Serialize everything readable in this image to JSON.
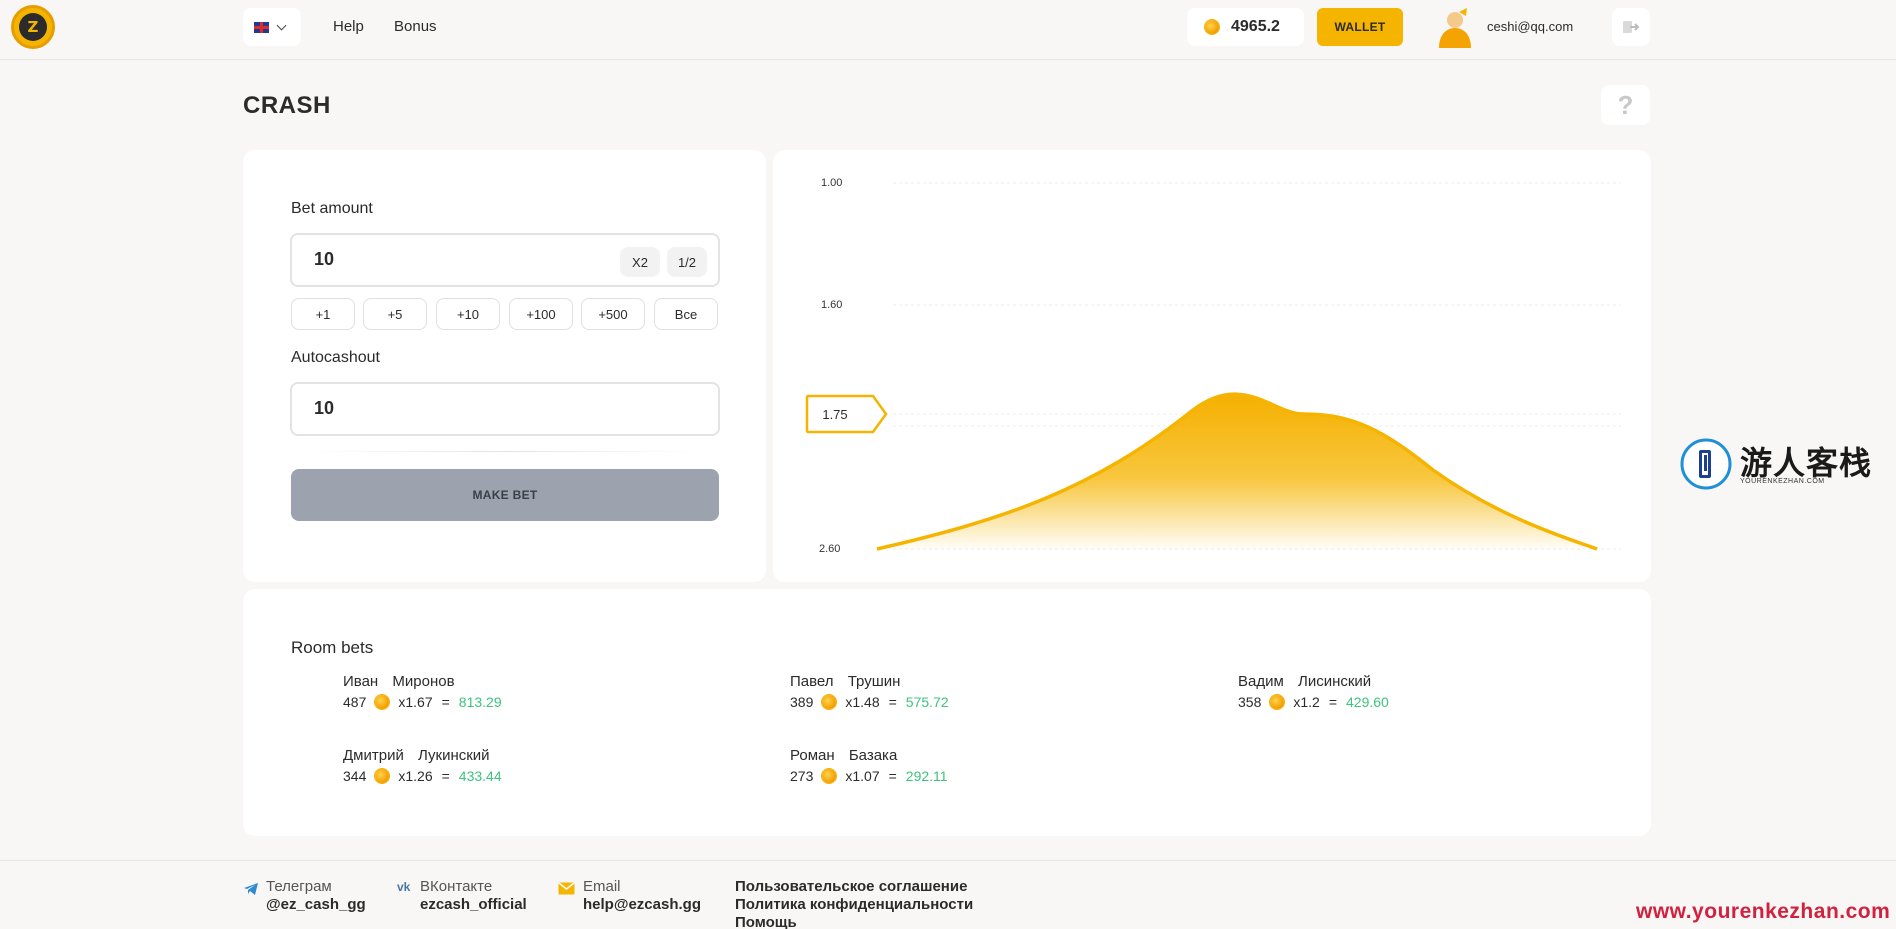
{
  "header": {
    "nav": [
      "Help",
      "Bonus"
    ],
    "balance": "4965.2",
    "wallet_label": "WALLET",
    "user_email": "ceshi@qq.com"
  },
  "page": {
    "title": "CRASH",
    "help_glyph": "?"
  },
  "bet": {
    "amount_label": "Bet amount",
    "amount_value": "10",
    "double_label": "X2",
    "half_label": "1/2",
    "quick_adds": [
      "+1",
      "+5",
      "+10",
      "+100",
      "+500",
      "Все"
    ],
    "autocashout_label": "Autocashout",
    "autocashout_value": "10",
    "make_bet_label": "MAKE BET"
  },
  "chart_data": {
    "type": "area",
    "y_ticks": [
      "1.00",
      "1.60",
      "2.60"
    ],
    "current_marker": "1.75",
    "color": "#f5b400",
    "shape": "bell curve peaking near the 1.75 marker"
  },
  "room_bets": {
    "title": "Room bets",
    "entries": [
      {
        "first": "Иван",
        "last": "Миронов",
        "amount": "487",
        "mult": "x1.67",
        "eq": "=",
        "win": "813.29"
      },
      {
        "first": "Павел",
        "last": "Трушин",
        "amount": "389",
        "mult": "x1.48",
        "eq": "=",
        "win": "575.72"
      },
      {
        "first": "Вадим",
        "last": "Лисинский",
        "amount": "358",
        "mult": "x1.2",
        "eq": "=",
        "win": "429.60"
      },
      {
        "first": "Дмитрий",
        "last": "Лукинский",
        "amount": "344",
        "mult": "x1.26",
        "eq": "=",
        "win": "433.44"
      },
      {
        "first": "Роман",
        "last": "Базака",
        "amount": "273",
        "mult": "x1.07",
        "eq": "=",
        "win": "292.11"
      }
    ]
  },
  "footer": {
    "telegram_label": "Телеграм",
    "telegram_value": "@ez_cash_gg",
    "vk_label": "ВКонтакте",
    "vk_value": "ezcash_official",
    "email_label": "Email",
    "email_value": "help@ezcash.gg",
    "links": [
      "Пользовательское соглашение",
      "Политика конфиденциальности",
      "Помощь"
    ]
  },
  "watermark": {
    "cn": "游人客栈",
    "en": "YOURENKEZHAN.COM",
    "url": "www.yourenkezhan.com"
  }
}
